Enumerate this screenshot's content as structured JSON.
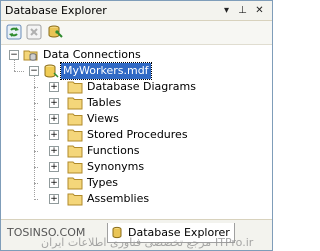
{
  "window": {
    "title": "Database Explorer",
    "controls": {
      "dropdown": "▾",
      "pin": "⊥",
      "close": "✕"
    }
  },
  "toolbar": {
    "buttons": [
      {
        "icon": "refresh-icon"
      },
      {
        "icon": "stop-icon"
      },
      {
        "icon": "connect-to-database-icon"
      }
    ]
  },
  "tree": {
    "root": {
      "label": "Data Connections",
      "expanded": true
    },
    "connection": {
      "label": "MyWorkers.mdf",
      "expanded": true,
      "selected": true
    },
    "folders": [
      {
        "label": "Database Diagrams"
      },
      {
        "label": "Tables"
      },
      {
        "label": "Views"
      },
      {
        "label": "Stored Procedures"
      },
      {
        "label": "Functions"
      },
      {
        "label": "Synonyms"
      },
      {
        "label": "Types"
      },
      {
        "label": "Assemblies"
      }
    ]
  },
  "bottom_tabs": {
    "inactive": "TOSINSO.COM",
    "active": "Database Explorer"
  },
  "watermark": {
    "left": "مرجع تخصصی فناوری اطلاعات ایران",
    "right": "ITPro.ir"
  },
  "colors": {
    "selection": "#316ac5",
    "folder": "#f4d67a",
    "titlebar": "#f3f3ee"
  }
}
